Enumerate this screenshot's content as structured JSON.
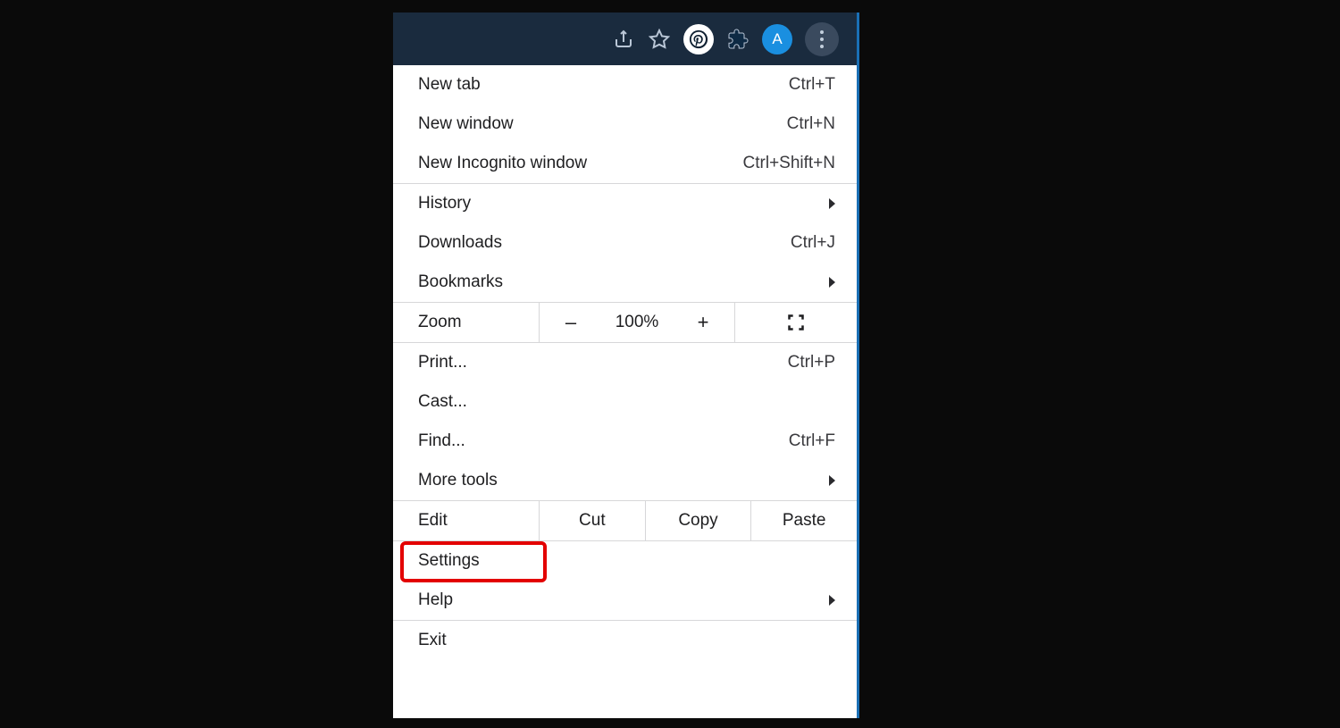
{
  "toolbar": {
    "profile_letter": "A"
  },
  "menu": {
    "group1": [
      {
        "label": "New tab",
        "shortcut": "Ctrl+T"
      },
      {
        "label": "New window",
        "shortcut": "Ctrl+N"
      },
      {
        "label": "New Incognito window",
        "shortcut": "Ctrl+Shift+N"
      }
    ],
    "group2": [
      {
        "label": "History",
        "submenu": true
      },
      {
        "label": "Downloads",
        "shortcut": "Ctrl+J"
      },
      {
        "label": "Bookmarks",
        "submenu": true
      }
    ],
    "zoom": {
      "label": "Zoom",
      "minus": "–",
      "value": "100%",
      "plus": "+"
    },
    "group3": [
      {
        "label": "Print...",
        "shortcut": "Ctrl+P"
      },
      {
        "label": "Cast..."
      },
      {
        "label": "Find...",
        "shortcut": "Ctrl+F"
      },
      {
        "label": "More tools",
        "submenu": true
      }
    ],
    "edit": {
      "label": "Edit",
      "cut": "Cut",
      "copy": "Copy",
      "paste": "Paste"
    },
    "group4": [
      {
        "label": "Settings"
      },
      {
        "label": "Help",
        "submenu": true
      }
    ],
    "group5": [
      {
        "label": "Exit"
      }
    ]
  },
  "highlight_item": "Settings"
}
